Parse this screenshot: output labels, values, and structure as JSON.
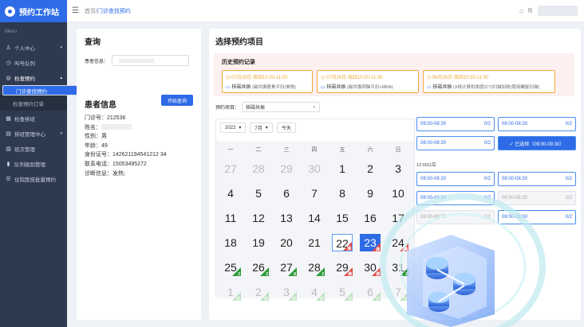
{
  "app": {
    "title": "预约工作站",
    "menu_caption": "Menu"
  },
  "sidebar": {
    "items": [
      {
        "label": "个人中心",
        "icon": "user-icon",
        "arrow": "▾"
      },
      {
        "label": "叫号队列",
        "icon": "clock-icon"
      },
      {
        "label": "检查预约",
        "icon": "target-icon",
        "arrow": "▴"
      },
      {
        "label": "门诊查找预约",
        "sub": true,
        "selected": true
      },
      {
        "label": "检查预约订单",
        "sub": true
      },
      {
        "label": "检查排班",
        "icon": "calendar-icon"
      },
      {
        "label": "排班管理中心",
        "icon": "grid-icon",
        "arrow": "▾"
      },
      {
        "label": "班次管理",
        "icon": "list-icon"
      },
      {
        "label": "队列级别管理",
        "icon": "bars-icon"
      },
      {
        "label": "住院医技批量预约",
        "icon": "menu-icon"
      }
    ]
  },
  "header": {
    "breadcrumb_home": "首页/",
    "breadcrumb_current": "门诊查找预约"
  },
  "query": {
    "title": "查询",
    "patient_label": "患者信息：",
    "search_button": "开始查询"
  },
  "patient": {
    "title": "患者信息",
    "clinic_no_label": "门诊号：",
    "clinic_no": "212536",
    "name_label": "姓名：",
    "gender_label": "性别：",
    "gender": "男",
    "age_label": "年龄：",
    "age": "49",
    "id_label": "身份证号：",
    "id": "142621194541212 34",
    "phone_label": "联系电话：",
    "phone": "15053495272",
    "diagnosis_label": "诊断信息：",
    "diagnosis": "发热;"
  },
  "select": {
    "title": "选择预约项目",
    "history_title": "历史预约记录",
    "history": [
      {
        "date": "07月28日 周四10:30-11:00",
        "name": "核磁共振",
        "desc": "(磁共振股骨平扫(单侧)"
      },
      {
        "date": "07月26日 周四10:30-11:00",
        "name": "核磁共振",
        "desc": "(磁共振颅脑平扫+MRA)"
      },
      {
        "date": "06月28日 周四10:30-11:00",
        "name": "核磁共振",
        "desc": "(X线计算机体层(CT)扫描加收(使用螺旋扫描)"
      }
    ],
    "item_label": "预约项目：",
    "item_value": "核磁共振"
  },
  "calendar": {
    "year": "2022",
    "month": "7月",
    "today": "今天",
    "weekdays": [
      "一",
      "二",
      "三",
      "四",
      "五",
      "六",
      "日"
    ]
  },
  "slots": {
    "top": [
      {
        "time": "08:00-08:30",
        "count": "0/2"
      },
      {
        "time": "08:00-08:30",
        "count": "0/2"
      },
      {
        "time": "08:00-08:30",
        "count": "0/2"
      },
      {
        "label": "✓ 已选择（09:00-09:30）"
      }
    ],
    "section_caption": "12:00以后",
    "bottom": [
      {
        "time": "08:00-08:30",
        "count": "0/2"
      },
      {
        "time": "08:00-08:30",
        "count": "0/2"
      },
      {
        "time": "08:00-08:30",
        "count": "0/2"
      },
      {
        "time": "08:00-08:30",
        "count": "2/2"
      },
      {
        "time": "08:00-08:30",
        "count": "2/2"
      },
      {
        "time": "08:00-08:30",
        "count": "0/2"
      }
    ]
  },
  "colors": {
    "primary": "#2e6be6",
    "sidebar": "#2e3a4f",
    "full": "#e04b4b",
    "available": "#2e9a3a"
  }
}
